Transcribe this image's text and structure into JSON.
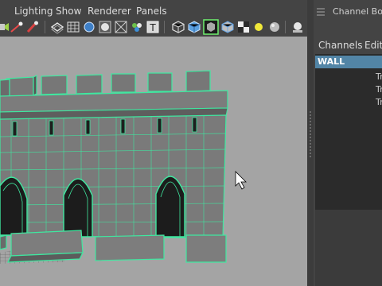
{
  "menubar": {
    "items": [
      {
        "label": "Lighting"
      },
      {
        "label": "Show"
      },
      {
        "label": "Renderer"
      },
      {
        "label": "Panels"
      }
    ]
  },
  "toolbar": {
    "icons": [
      "select-camera-icon",
      "grid-icon",
      "film-gate-icon",
      "wireframe-icon",
      "smooth-shade-icon",
      "xray-icon",
      "textured-icon",
      "lights-icon",
      "shaded-cube-icon",
      "wireframe-on-shaded-icon",
      "isolate-icon",
      "checker-icon",
      "light-bulb-icon",
      "sphere-icon",
      "render-sphere-icon"
    ]
  },
  "channel_box": {
    "title": "Channel Box /",
    "menus": [
      {
        "label": "Channels"
      },
      {
        "label": "Edit"
      }
    ],
    "object_name": "WALL",
    "attributes": [
      "Tr",
      "Tr",
      "Tr"
    ]
  },
  "colors": {
    "viewport_bg": "#a4a4a4",
    "wire_highlight": "#3fe8a0",
    "selection_blue": "#5285a6"
  }
}
